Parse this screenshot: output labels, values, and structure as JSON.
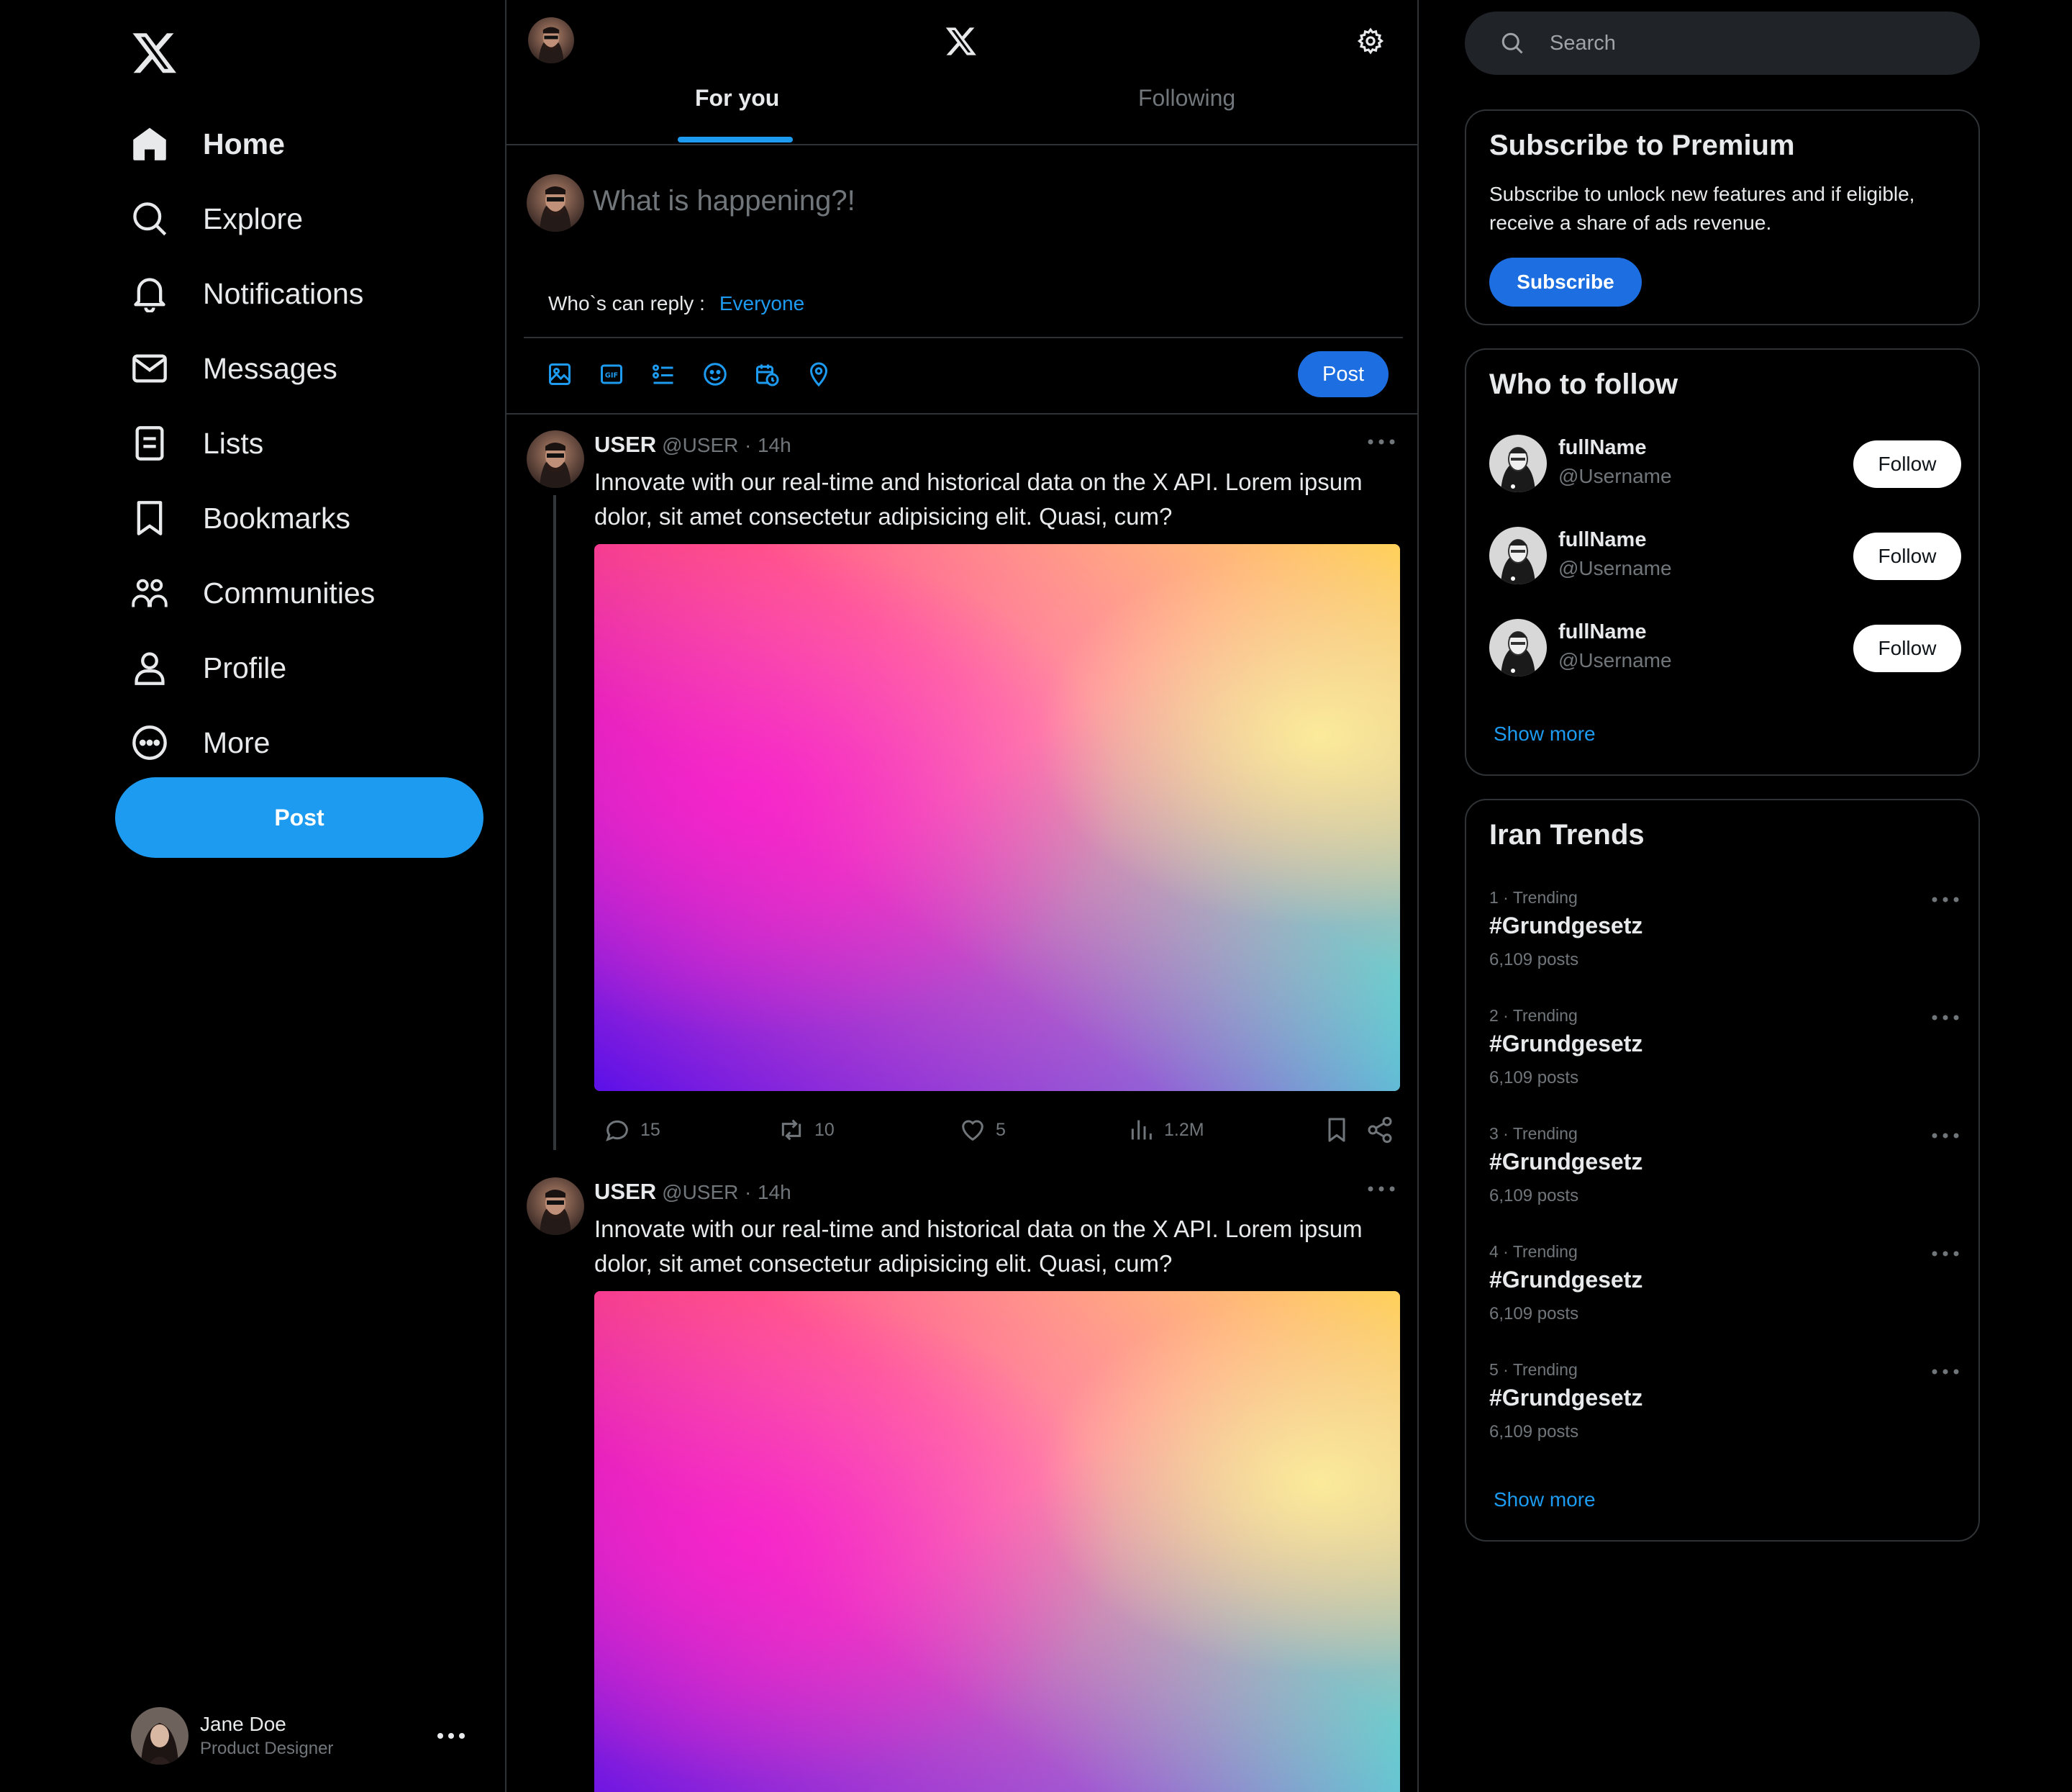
{
  "sidebar": {
    "nav": [
      {
        "label": "Home",
        "icon": "home-icon"
      },
      {
        "label": "Explore",
        "icon": "search-icon"
      },
      {
        "label": "Notifications",
        "icon": "bell-icon"
      },
      {
        "label": "Messages",
        "icon": "mail-icon"
      },
      {
        "label": "Lists",
        "icon": "list-icon"
      },
      {
        "label": "Bookmarks",
        "icon": "bookmark-icon"
      },
      {
        "label": "Communities",
        "icon": "communities-icon"
      },
      {
        "label": "Profile",
        "icon": "profile-icon"
      },
      {
        "label": "More",
        "icon": "more-circle-icon"
      }
    ],
    "post_button": "Post",
    "account": {
      "name": "Jane Doe",
      "role": "Product Designer"
    }
  },
  "header": {
    "tabs": [
      {
        "label": "For you",
        "active": true
      },
      {
        "label": "Following",
        "active": false
      }
    ]
  },
  "composer": {
    "placeholder": "What is happening?!",
    "reply_label": "Who`s can reply :",
    "reply_value": "Everyone",
    "tools": [
      "image-icon",
      "gif-icon",
      "poll-icon",
      "emoji-icon",
      "schedule-icon",
      "location-icon"
    ],
    "post_button": "Post"
  },
  "posts": [
    {
      "name": "USER",
      "handle": "@USER",
      "dot": "·",
      "time": "14h",
      "text": "Innovate with our real-time and historical data on the X API. Lorem ipsum dolor, sit amet consectetur adipisicing elit. Quasi, cum?",
      "replies": "15",
      "reposts": "10",
      "likes": "5",
      "views": "1.2M"
    },
    {
      "name": "USER",
      "handle": "@USER",
      "dot": "·",
      "time": "14h",
      "text": "Innovate with our real-time and historical data on the X API. Lorem ipsum dolor, sit amet consectetur adipisicing elit. Quasi, cum?"
    }
  ],
  "search": {
    "placeholder": "Search"
  },
  "premium": {
    "title": "Subscribe to Premium",
    "text": "Subscribe to unlock new features and if eligible, receive a share of ads revenue.",
    "button": "Subscribe"
  },
  "who_to_follow": {
    "title": "Who to follow",
    "users": [
      {
        "name": "fullName",
        "handle": "@Username",
        "button": "Follow"
      },
      {
        "name": "fullName",
        "handle": "@Username",
        "button": "Follow"
      },
      {
        "name": "fullName",
        "handle": "@Username",
        "button": "Follow"
      }
    ],
    "show_more": "Show more"
  },
  "trends": {
    "title": "Iran Trends",
    "items": [
      {
        "meta": "1 · Trending",
        "tag": "#Grundgesetz",
        "count": "6,109 posts"
      },
      {
        "meta": "2 · Trending",
        "tag": "#Grundgesetz",
        "count": "6,109 posts"
      },
      {
        "meta": "3 · Trending",
        "tag": "#Grundgesetz",
        "count": "6,109 posts"
      },
      {
        "meta": "4 · Trending",
        "tag": "#Grundgesetz",
        "count": "6,109 posts"
      },
      {
        "meta": "5 · Trending",
        "tag": "#Grundgesetz",
        "count": "6,109 posts"
      }
    ],
    "show_more": "Show more"
  },
  "colors": {
    "background": "#000000",
    "accent": "#1d9bf0",
    "button_blue": "#1d6ee0",
    "border": "#2f3336",
    "muted": "#71767b"
  }
}
